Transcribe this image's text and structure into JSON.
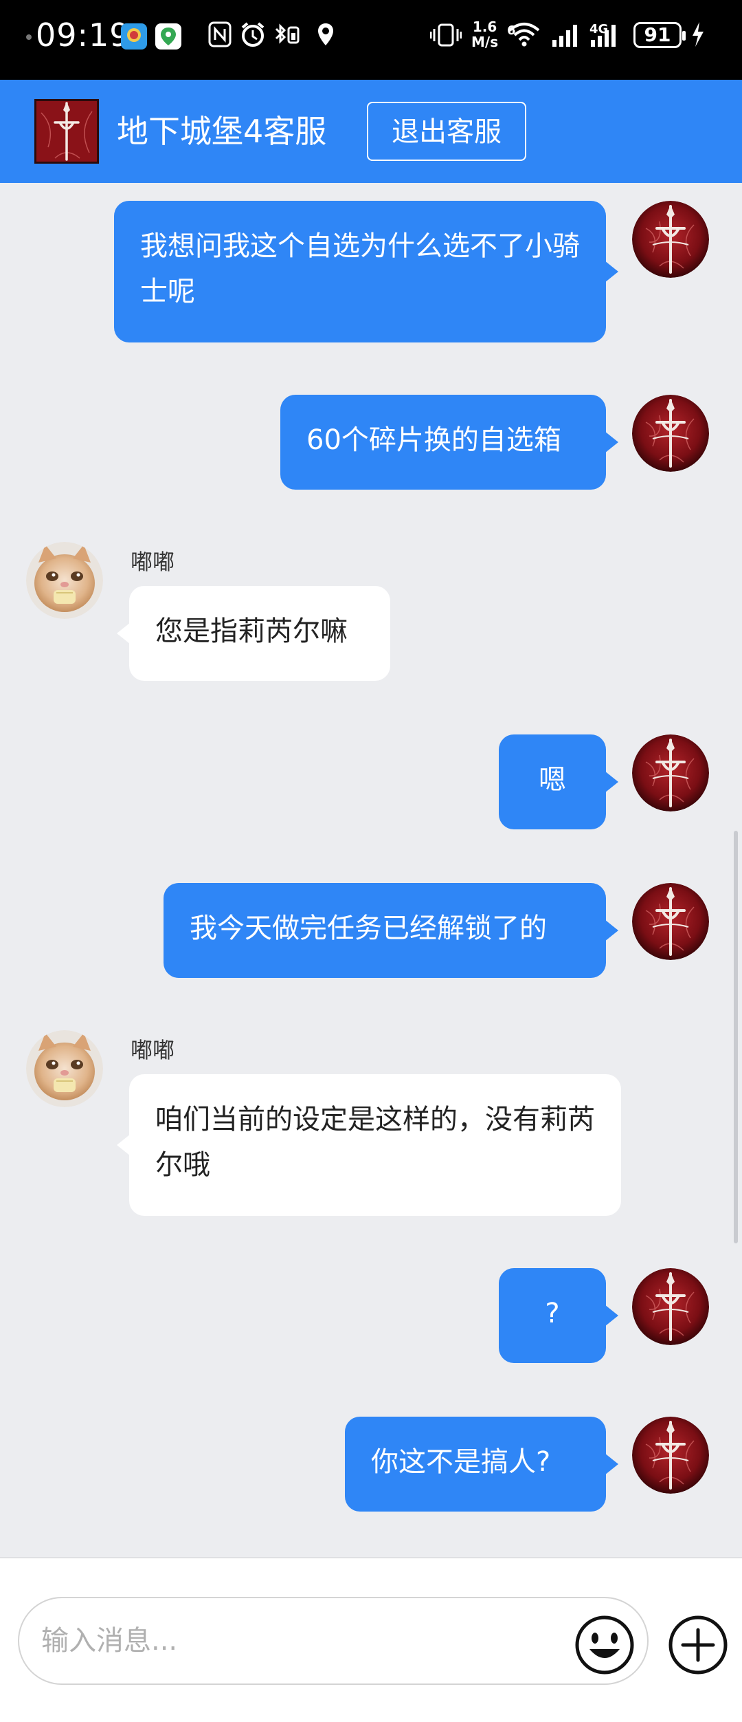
{
  "status_bar": {
    "time": "09:19",
    "speed_value": "1.6",
    "speed_unit": "M/s",
    "network": "4G",
    "wifi_label": "6",
    "battery": "91"
  },
  "header": {
    "title": "地下城堡4客服",
    "exit_label": "退出客服"
  },
  "messages": [
    {
      "from": "me",
      "text": "我想问我这个自选为什么选不了小骑士呢"
    },
    {
      "from": "me",
      "text": "60个碎片换的自选箱"
    },
    {
      "from": "them",
      "sender": "嘟嘟",
      "text": "您是指莉芮尔嘛"
    },
    {
      "from": "me",
      "text": "嗯"
    },
    {
      "from": "me",
      "text": "我今天做完任务已经解锁了的"
    },
    {
      "from": "them",
      "sender": "嘟嘟",
      "text": "咱们当前的设定是这样的，没有莉芮尔哦"
    },
    {
      "from": "me",
      "text": "?"
    },
    {
      "from": "me",
      "text": "你这不是搞人?"
    }
  ],
  "input": {
    "placeholder": "输入消息..."
  },
  "icons": {
    "emoji": "emoji-smile-icon",
    "plus": "plus-circle-icon"
  },
  "colors": {
    "accent": "#2f86f6",
    "chat_bg": "#ecedf0",
    "status_bar": "#000000"
  }
}
